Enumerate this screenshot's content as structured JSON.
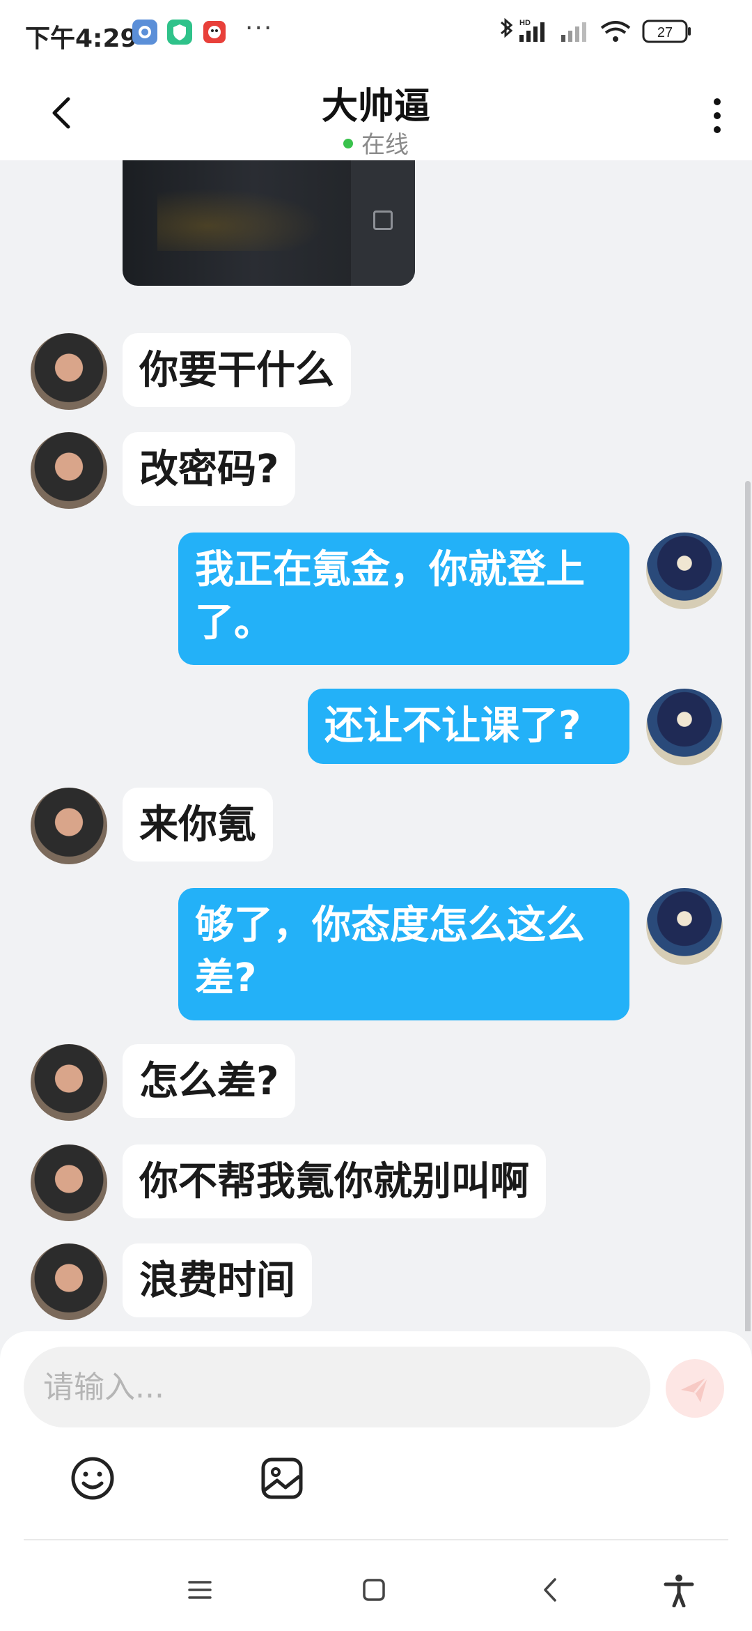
{
  "status_bar": {
    "time": "下午4:29",
    "more": "···",
    "battery": "27",
    "network_label": "HD"
  },
  "header": {
    "title": "大帅逼",
    "status": "在线"
  },
  "messages": [
    {
      "side": "in",
      "text": "你要干什么"
    },
    {
      "side": "in",
      "text": "改密码?"
    },
    {
      "side": "out",
      "text": "我正在氪金，你就登上了。"
    },
    {
      "side": "out",
      "text": "还让不让课了?"
    },
    {
      "side": "in",
      "text": "来你氪"
    },
    {
      "side": "out",
      "text": "够了，你态度怎么这么差?"
    },
    {
      "side": "in",
      "text": "怎么差?"
    },
    {
      "side": "in",
      "text": "你不帮我氪你就别叫啊"
    },
    {
      "side": "in",
      "text": "浪费时间"
    }
  ],
  "composer": {
    "placeholder": "请输入..."
  },
  "colors": {
    "accent": "#23b1f8",
    "online_dot": "#39c24c",
    "chat_background": "#f1f2f4"
  },
  "icons": {
    "back": "chevron-left-icon",
    "menu": "more-vertical-icon",
    "send": "paper-plane-icon",
    "emoji": "smiley-icon",
    "image": "image-icon",
    "nav": [
      "menu-icon",
      "home-icon",
      "back-icon",
      "accessibility-icon"
    ]
  }
}
